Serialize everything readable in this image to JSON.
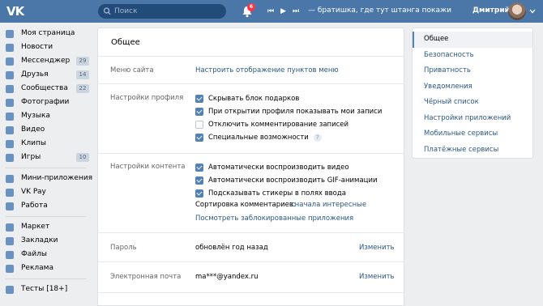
{
  "topbar": {
    "logo": "VK",
    "search_placeholder": "Поиск",
    "notifications_count": "6",
    "track": "— братишка, где тут штанга покажи",
    "user_name": "Дмитрий"
  },
  "leftnav": {
    "items": [
      {
        "label": "Моя страница",
        "icon": "user-icon",
        "count": ""
      },
      {
        "label": "Новости",
        "icon": "news-icon",
        "count": ""
      },
      {
        "label": "Мессенджер",
        "icon": "chat-icon",
        "count": "29"
      },
      {
        "label": "Друзья",
        "icon": "friends-icon",
        "count": "14"
      },
      {
        "label": "Сообщества",
        "icon": "groups-icon",
        "count": "22"
      },
      {
        "label": "Фотографии",
        "icon": "camera-icon",
        "count": ""
      },
      {
        "label": "Музыка",
        "icon": "music-icon",
        "count": ""
      },
      {
        "label": "Видео",
        "icon": "video-icon",
        "count": ""
      },
      {
        "label": "Клипы",
        "icon": "clips-icon",
        "count": ""
      },
      {
        "label": "Игры",
        "icon": "games-icon",
        "count": "10"
      }
    ],
    "items2": [
      {
        "label": "Мини-приложения",
        "icon": "apps-icon"
      },
      {
        "label": "VK Pay",
        "icon": "vkpay-icon"
      },
      {
        "label": "Работа",
        "icon": "briefcase-icon"
      }
    ],
    "items3": [
      {
        "label": "Маркет",
        "icon": "market-icon"
      },
      {
        "label": "Закладки",
        "icon": "star-icon"
      },
      {
        "label": "Файлы",
        "icon": "file-icon"
      },
      {
        "label": "Реклама",
        "icon": "ads-icon"
      }
    ],
    "items4": [
      {
        "label": "Тесты [18+]",
        "icon": "tests-icon"
      }
    ]
  },
  "main": {
    "title": "Общее",
    "site_menu": {
      "label": "Меню сайта",
      "link": "Настроить отображение пунктов меню"
    },
    "profile": {
      "label": "Настройки профиля",
      "options": [
        {
          "text": "Скрывать блок подарков",
          "checked": true
        },
        {
          "text": "При открытии профиля показывать мои записи",
          "checked": true
        },
        {
          "text": "Отключить комментирование записей",
          "checked": false
        },
        {
          "text": "Специальные возможности",
          "checked": true
        }
      ],
      "help": "?"
    },
    "content": {
      "label": "Настройки контента",
      "options": [
        {
          "text": "Автоматически воспроизводить видео",
          "checked": true
        },
        {
          "text": "Автоматически воспроизводить GIF-анимации",
          "checked": true
        },
        {
          "text": "Подсказывать стикеры в полях ввода",
          "checked": true
        }
      ],
      "sort_label": "Сортировка комментариев:",
      "sort_value": "сначала интересные",
      "blocked_link": "Посмотреть заблокированные приложения"
    },
    "password": {
      "label": "Пароль",
      "value": "обновлён год назад",
      "action": "Изменить"
    },
    "email": {
      "label": "Электронная почта",
      "value": "ma***@yandex.ru",
      "action": "Изменить"
    }
  },
  "rightnav": {
    "items": [
      "Общее",
      "Безопасность",
      "Приватность",
      "Уведомления",
      "Чёрный список",
      "Настройки приложений",
      "Мобильные сервисы",
      "Платёжные сервисы"
    ]
  },
  "colors": {
    "header": "#4a76a8",
    "accent": "#5181b8",
    "link": "#2a5885",
    "background": "#edeef0"
  }
}
